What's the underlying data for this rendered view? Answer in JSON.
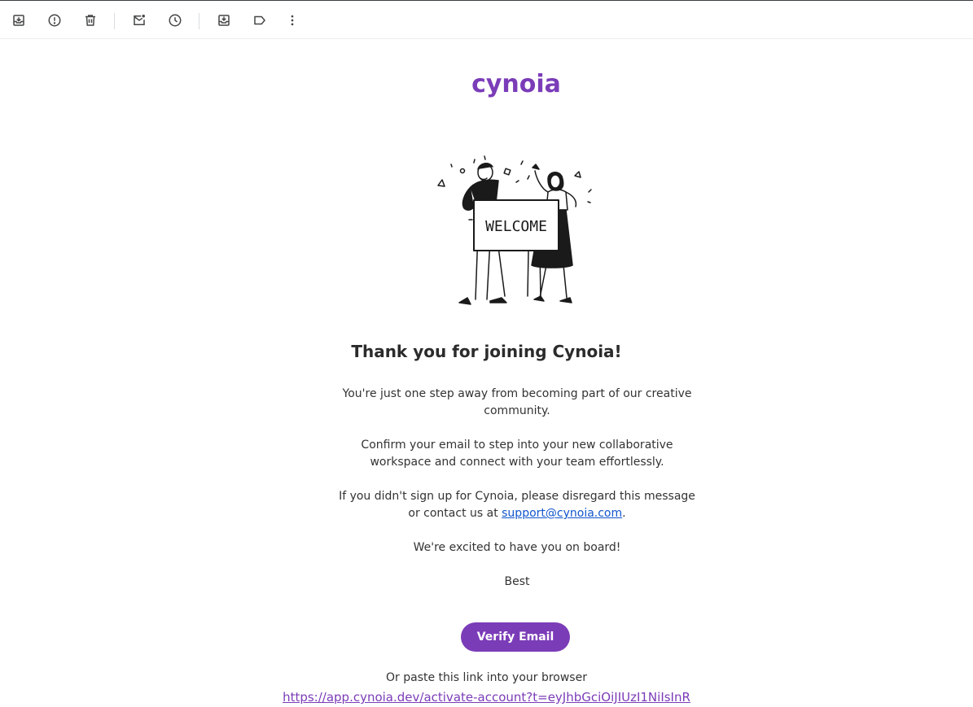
{
  "toolbar": {
    "buttons": [
      {
        "name": "archive",
        "icon": "archive-icon"
      },
      {
        "name": "report-spam",
        "icon": "report-spam-icon"
      },
      {
        "name": "delete",
        "icon": "trash-icon"
      },
      {
        "name": "mark-unread",
        "icon": "mark-unread-icon"
      },
      {
        "name": "snooze",
        "icon": "clock-icon"
      },
      {
        "name": "move-to",
        "icon": "move-to-inbox-icon"
      },
      {
        "name": "label",
        "icon": "label-icon"
      },
      {
        "name": "more",
        "icon": "more-vert-icon"
      }
    ]
  },
  "email": {
    "logo_text": "cynoia",
    "brand_color": "#7b3cb8",
    "illustration_sign": "WELCOME",
    "headline": "Thank you for joining Cynoia!",
    "p1": "You're just one step away from becoming part of our creative community.",
    "p2": "Confirm your email to step into your new collaborative workspace and connect with your team effortlessly.",
    "p3_before": "If you didn't sign up for Cynoia, please disregard this message or contact us at ",
    "p3_link": "support@cynoia.com",
    "p3_after": ".",
    "p4": "We're excited to have you on board!",
    "p5": "Best",
    "verify_label": "Verify Email",
    "paste_label": "Or paste this link into your browser",
    "activation_link": "https://app.cynoia.dev/activate-account?t=eyJhbGciOiJIUzI1NiIsInR"
  }
}
